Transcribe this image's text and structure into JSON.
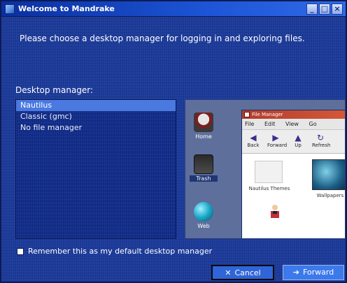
{
  "window": {
    "title": "Welcome to Mandrake"
  },
  "intro": {
    "text": "Please choose a desktop manager for logging in and exploring files."
  },
  "desktop_manager": {
    "label": "Desktop manager:",
    "items": [
      {
        "label": "Nautilus",
        "selected": true
      },
      {
        "label": "Classic (gmc)",
        "selected": false
      },
      {
        "label": "No file manager",
        "selected": false
      }
    ]
  },
  "preview": {
    "desktop_icons": [
      {
        "name": "home",
        "label": "Home"
      },
      {
        "name": "trash",
        "label": "Trash"
      },
      {
        "name": "web",
        "label": "Web"
      }
    ],
    "file_manager": {
      "title": "File Manager",
      "menu": [
        "File",
        "Edit",
        "View",
        "Go"
      ],
      "toolbar": [
        "Back",
        "Forward",
        "Up",
        "Refresh"
      ],
      "items": [
        "Nautilus Themes",
        "Wallpapers"
      ]
    }
  },
  "checkbox": {
    "label": "Remember this as my default desktop manager",
    "checked": false
  },
  "buttons": {
    "cancel_label": "Cancel",
    "cancel_symbol": "✕",
    "forward_label": "Forward",
    "forward_symbol": "➔"
  },
  "colors": {
    "window_bg": "#1b3a9a",
    "selection": "#4a79e0",
    "titlebar": "#1d55d6"
  }
}
